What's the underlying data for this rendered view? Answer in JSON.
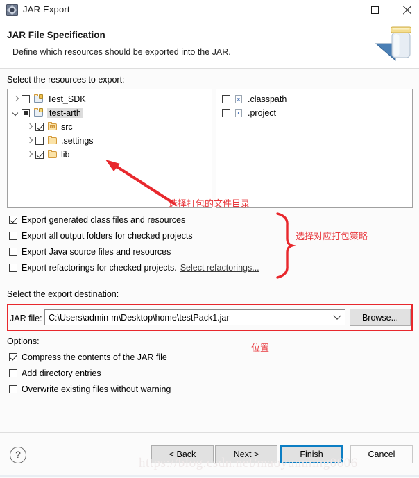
{
  "window": {
    "title": "JAR Export",
    "icon": "jar-export-icon",
    "controls": {
      "minimize": "minimize-icon",
      "maximize": "maximize-icon",
      "close": "close-icon"
    }
  },
  "header": {
    "title": "JAR File Specification",
    "subtitle": "Define which resources should be exported into the JAR.",
    "banner_icon": "jar-bottle-icon"
  },
  "labels": {
    "resources": "Select the resources to export:",
    "destination": "Select the export destination:",
    "options": "Options:",
    "jar_file": "JAR file:"
  },
  "tree": [
    {
      "label": "Test_SDK",
      "icon": "java-project-warning-icon",
      "checkbox": "unchecked",
      "twisty": "collapsed",
      "indent": 0,
      "selected": false
    },
    {
      "label": "test-arth",
      "icon": "java-project-icon",
      "checkbox": "partial",
      "twisty": "expanded",
      "indent": 0,
      "selected": true
    },
    {
      "label": "src",
      "icon": "source-folder-icon",
      "checkbox": "checked",
      "twisty": "collapsed",
      "indent": 1,
      "selected": false
    },
    {
      "label": ".settings",
      "icon": "folder-icon",
      "checkbox": "unchecked",
      "twisty": "collapsed",
      "indent": 1,
      "selected": false
    },
    {
      "label": "lib",
      "icon": "folder-icon",
      "checkbox": "checked",
      "twisty": "collapsed",
      "indent": 1,
      "selected": false
    }
  ],
  "file_list": [
    {
      "label": ".classpath",
      "icon": "xml-file-icon",
      "glyph": "x",
      "checkbox": "unchecked"
    },
    {
      "label": ".project",
      "icon": "xml-file-icon",
      "glyph": "x",
      "checkbox": "unchecked"
    }
  ],
  "export_options": [
    {
      "label": "Export generated class files and resources",
      "checkbox": "checked",
      "link": null
    },
    {
      "label": "Export all output folders for checked projects",
      "checkbox": "unchecked",
      "link": null
    },
    {
      "label": "Export Java source files and resources",
      "checkbox": "unchecked",
      "link": null
    },
    {
      "label": "Export refactorings for checked projects.",
      "checkbox": "unchecked",
      "link": "Select refactorings..."
    }
  ],
  "jar_options": [
    {
      "label": "Compress the contents of the JAR file",
      "checkbox": "checked"
    },
    {
      "label": "Add directory entries",
      "checkbox": "unchecked"
    },
    {
      "label": "Overwrite existing files without warning",
      "checkbox": "unchecked"
    }
  ],
  "destination": {
    "jar_file_path": "C:\\Users\\admin-m\\Desktop\\home\\testPack1.jar",
    "browse_label": "Browse...",
    "dropdown_icon": "chevron-down-icon"
  },
  "footer": {
    "help_icon": "?",
    "buttons": [
      {
        "label": "< Back",
        "name": "back-button",
        "primary": false,
        "enabled": true
      },
      {
        "label": "Next >",
        "name": "next-button",
        "primary": false,
        "enabled": true
      },
      {
        "label": "Finish",
        "name": "finish-button",
        "primary": true,
        "enabled": true
      },
      {
        "label": "Cancel",
        "name": "cancel-button",
        "primary": false,
        "enabled": true
      }
    ]
  },
  "annotations": [
    {
      "text": "选择打包的文件目录",
      "name": "annotation-select-folder"
    },
    {
      "text": "选择对应打包策略",
      "name": "annotation-select-strategy"
    },
    {
      "text": "位置",
      "name": "annotation-location"
    }
  ],
  "watermark": "https://blog.csdn.net/maoyunming0606",
  "colors": {
    "accent": "#0c7ec4",
    "annotation_red": "#e8383d",
    "highlight_box": "#e8282d",
    "folder_yellow": "#fdf0cd",
    "dialog_bg": "#fbfbfb"
  }
}
